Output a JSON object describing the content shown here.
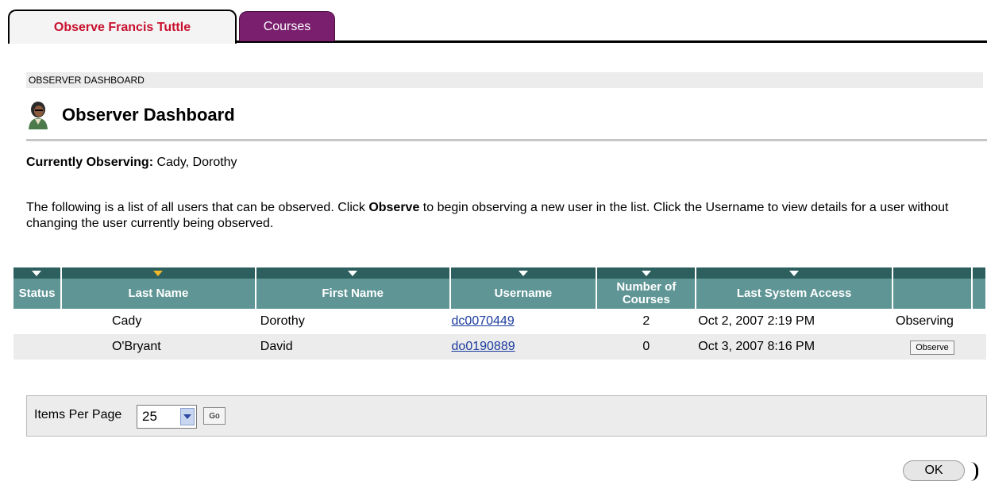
{
  "tabs": [
    {
      "label": "Observe Francis Tuttle"
    },
    {
      "label": "Courses"
    }
  ],
  "breadcrumb": "OBSERVER DASHBOARD",
  "page_title": "Observer Dashboard",
  "currently_observing": {
    "label": "Currently Observing:",
    "value": " Cady, Dorothy"
  },
  "description": {
    "part1": "The following is a list of all users that can be observed. Click ",
    "bold": "Observe",
    "part2": " to begin observing a new user in the list. Click the Username to view details for a user without changing the user currently being observed."
  },
  "table": {
    "columns": [
      "Status",
      "Last Name",
      "First Name",
      "Username",
      "Number of Courses",
      "Last System Access",
      ""
    ],
    "sorted_column": "Last Name",
    "rows": [
      {
        "status": "",
        "last_name": "Cady",
        "first_name": "Dorothy",
        "username": "dc0070449",
        "courses": "2",
        "last_access": "Oct 2, 2007 2:19 PM",
        "action": "Observing"
      },
      {
        "status": "",
        "last_name": "O'Bryant",
        "first_name": "David",
        "username": "do0190889",
        "courses": "0",
        "last_access": "Oct 3, 2007 8:16 PM",
        "action": "Observe"
      }
    ]
  },
  "pager": {
    "label": "Items Per Page",
    "value": "25",
    "go_label": "Go"
  },
  "ok_label": "OK",
  "colors": {
    "tab_active_text": "#c8102e",
    "tab_courses_bg": "#7a1f6e",
    "header_bg": "#5f9595",
    "link": "#1a3b9e"
  },
  "icons": {
    "avatar": "observer-avatar-icon",
    "sort": "sort-arrow-icon",
    "dropdown": "chevron-down-icon"
  }
}
